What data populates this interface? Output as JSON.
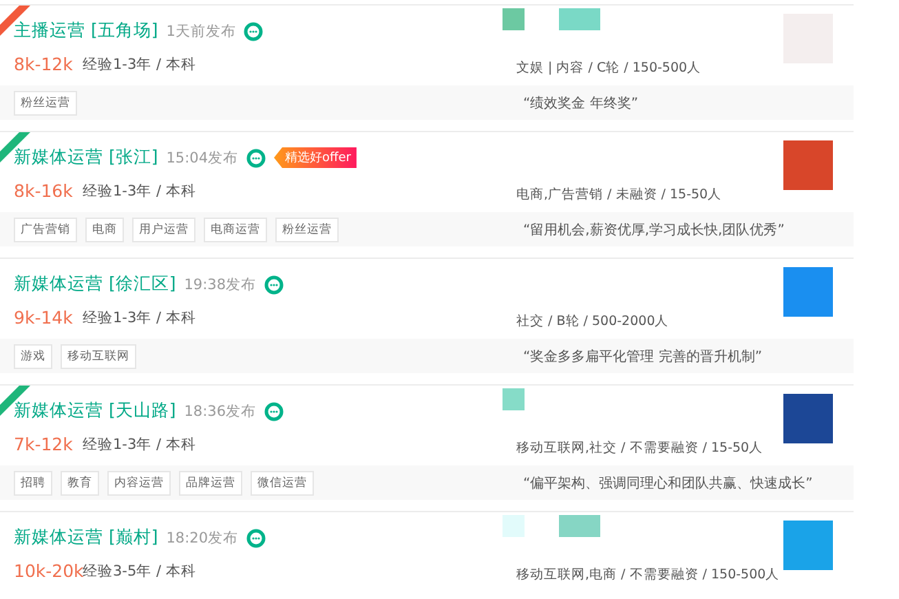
{
  "jobs": [
    {
      "title": "主播运营 [五角场]",
      "posted": "1天前发布",
      "ribbon": {
        "color": "#f25a3c"
      },
      "salary": "8k-12k",
      "requirements": "经验1-3年 / 本科",
      "company_info": "文娱 | 内容 / C轮 / 150-500人",
      "tags": [
        "粉丝运营"
      ],
      "benefits": "“绩效奖金 年终奖”",
      "logo": {
        "color": "#f4eeee"
      },
      "masks": [
        {
          "color": "#6cc9a2"
        },
        {
          "color": "#7ad9c6"
        }
      ]
    },
    {
      "title": "新媒体运营 [张江]",
      "posted": "15:04发布",
      "ribbon": {
        "color": "#1fb67b"
      },
      "offer_badge": "精选好offer",
      "salary": "8k-16k",
      "requirements": "经验1-3年 / 本科",
      "company_info": "电商,广告营销 / 未融资 / 15-50人",
      "tags": [
        "广告营销",
        "电商",
        "用户运营",
        "电商运营",
        "粉丝运营"
      ],
      "benefits": "“留用机会,薪资优厚,学习成长快,团队优秀”",
      "logo": {
        "color": "#d8462a"
      }
    },
    {
      "title": "新媒体运营 [徐汇区]",
      "posted": "19:38发布",
      "salary": "9k-14k",
      "requirements": "经验1-3年 / 本科",
      "company_info": "社交 / B轮 / 500-2000人",
      "tags": [
        "游戏",
        "移动互联网"
      ],
      "benefits": "“奖金多多扁平化管理 完善的晋升机制”",
      "logo": {
        "color": "#1a8ff0"
      }
    },
    {
      "title": "新媒体运营 [天山路]",
      "posted": "18:36发布",
      "ribbon": {
        "color": "#1fb67b"
      },
      "salary": "7k-12k",
      "requirements": "经验1-3年 / 本科",
      "company_info": "移动互联网,社交 / 不需要融资 / 15-50人",
      "tags": [
        "招聘",
        "教育",
        "内容运营",
        "品牌运营",
        "微信运营"
      ],
      "benefits": "“偏平架构、强调同理心和团队共赢、快速成长”",
      "logo": {
        "color": "#1c4796"
      },
      "masks": [
        {
          "color": "#86dcc8"
        }
      ]
    },
    {
      "title": "新媒体运营 [巅村]",
      "posted": "18:20发布",
      "salary": "10k-20k",
      "requirements": "经验3-5年 / 本科",
      "company_info": "移动互联网,电商 / 不需要融资 / 150-500人",
      "logo": {
        "color": "#1aa3e8"
      },
      "masks": [
        {
          "color": "#e2fbfb"
        },
        {
          "color": "#86d6c4"
        }
      ]
    }
  ]
}
